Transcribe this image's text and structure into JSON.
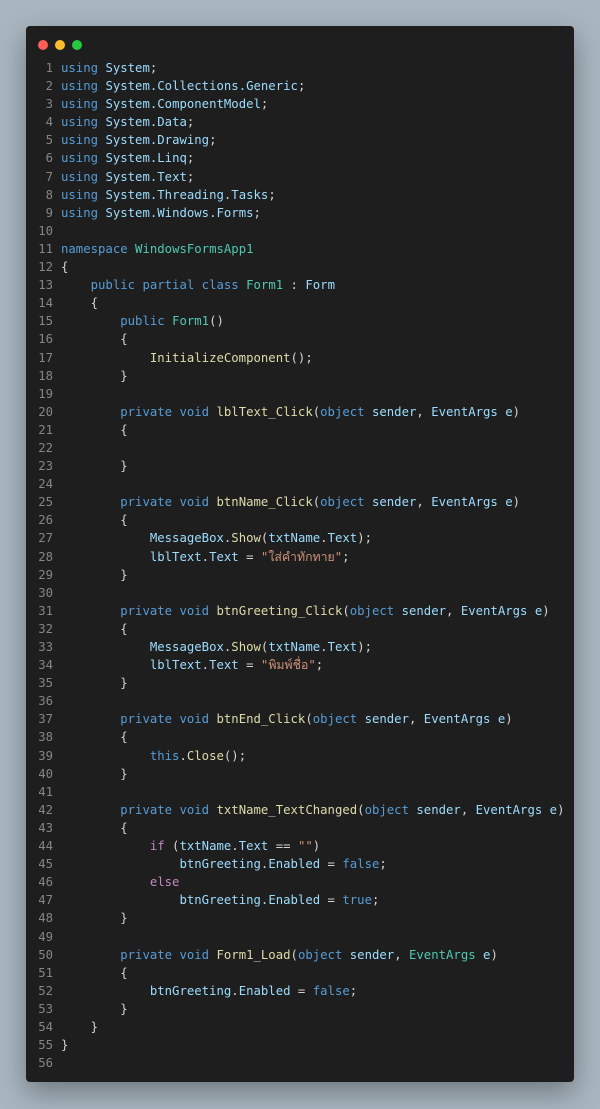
{
  "window": {
    "controls": [
      {
        "name": "close-button",
        "color": "#ff5f56"
      },
      {
        "name": "minimize-button",
        "color": "#ffbd2e"
      },
      {
        "name": "zoom-button",
        "color": "#27c93f"
      }
    ]
  },
  "editor": {
    "lines": [
      [
        [
          "kw",
          "using"
        ],
        [
          "p",
          " "
        ],
        [
          "var",
          "System"
        ],
        [
          "p",
          ";"
        ]
      ],
      [
        [
          "kw",
          "using"
        ],
        [
          "p",
          " "
        ],
        [
          "var",
          "System.Collections.Generic"
        ],
        [
          "p",
          ";"
        ]
      ],
      [
        [
          "kw",
          "using"
        ],
        [
          "p",
          " "
        ],
        [
          "var",
          "System.ComponentModel"
        ],
        [
          "p",
          ";"
        ]
      ],
      [
        [
          "kw",
          "using"
        ],
        [
          "p",
          " "
        ],
        [
          "var",
          "System.Data"
        ],
        [
          "p",
          ";"
        ]
      ],
      [
        [
          "kw",
          "using"
        ],
        [
          "p",
          " "
        ],
        [
          "var",
          "System.Drawing"
        ],
        [
          "p",
          ";"
        ]
      ],
      [
        [
          "kw",
          "using"
        ],
        [
          "p",
          " "
        ],
        [
          "var",
          "System.Linq"
        ],
        [
          "p",
          ";"
        ]
      ],
      [
        [
          "kw",
          "using"
        ],
        [
          "p",
          " "
        ],
        [
          "var",
          "System.Text"
        ],
        [
          "p",
          ";"
        ]
      ],
      [
        [
          "kw",
          "using"
        ],
        [
          "p",
          " "
        ],
        [
          "var",
          "System.Threading.Tasks"
        ],
        [
          "p",
          ";"
        ]
      ],
      [
        [
          "kw",
          "using"
        ],
        [
          "p",
          " "
        ],
        [
          "var",
          "System.Windows.Forms"
        ],
        [
          "p",
          ";"
        ]
      ],
      [],
      [
        [
          "kw",
          "namespace"
        ],
        [
          "p",
          " "
        ],
        [
          "type",
          "WindowsFormsApp1"
        ]
      ],
      [
        [
          "p",
          "{"
        ]
      ],
      [
        [
          "p",
          "    "
        ],
        [
          "kw",
          "public partial class"
        ],
        [
          "p",
          " "
        ],
        [
          "type",
          "Form1"
        ],
        [
          "p",
          " : "
        ],
        [
          "var",
          "Form"
        ]
      ],
      [
        [
          "p",
          "    {"
        ]
      ],
      [
        [
          "p",
          "        "
        ],
        [
          "kw",
          "public"
        ],
        [
          "p",
          " "
        ],
        [
          "type",
          "Form1"
        ],
        [
          "p",
          "()"
        ]
      ],
      [
        [
          "p",
          "        {"
        ]
      ],
      [
        [
          "p",
          "            "
        ],
        [
          "fn",
          "InitializeComponent"
        ],
        [
          "p",
          "();"
        ]
      ],
      [
        [
          "p",
          "        }"
        ]
      ],
      [],
      [
        [
          "p",
          "        "
        ],
        [
          "kw",
          "private void"
        ],
        [
          "p",
          " "
        ],
        [
          "fn",
          "lblText_Click"
        ],
        [
          "p",
          "("
        ],
        [
          "kw",
          "object"
        ],
        [
          "p",
          " "
        ],
        [
          "var",
          "sender"
        ],
        [
          "p",
          ", "
        ],
        [
          "var",
          "EventArgs"
        ],
        [
          "p",
          " "
        ],
        [
          "var",
          "e"
        ],
        [
          "p",
          ")"
        ]
      ],
      [
        [
          "p",
          "        {"
        ]
      ],
      [],
      [
        [
          "p",
          "        }"
        ]
      ],
      [],
      [
        [
          "p",
          "        "
        ],
        [
          "kw",
          "private void"
        ],
        [
          "p",
          " "
        ],
        [
          "fn",
          "btnName_Click"
        ],
        [
          "p",
          "("
        ],
        [
          "kw",
          "object"
        ],
        [
          "p",
          " "
        ],
        [
          "var",
          "sender"
        ],
        [
          "p",
          ", "
        ],
        [
          "var",
          "EventArgs"
        ],
        [
          "p",
          " "
        ],
        [
          "var",
          "e"
        ],
        [
          "p",
          ")"
        ]
      ],
      [
        [
          "p",
          "        {"
        ]
      ],
      [
        [
          "p",
          "            "
        ],
        [
          "var",
          "MessageBox"
        ],
        [
          "p",
          "."
        ],
        [
          "fn",
          "Show"
        ],
        [
          "p",
          "("
        ],
        [
          "var",
          "txtName"
        ],
        [
          "p",
          "."
        ],
        [
          "var",
          "Text"
        ],
        [
          "p",
          ");"
        ]
      ],
      [
        [
          "p",
          "            "
        ],
        [
          "var",
          "lblText"
        ],
        [
          "p",
          "."
        ],
        [
          "var",
          "Text"
        ],
        [
          "p",
          " = "
        ],
        [
          "str",
          "\"ใส่คำทักทาย\""
        ],
        [
          "p",
          ";"
        ]
      ],
      [
        [
          "p",
          "        }"
        ]
      ],
      [],
      [
        [
          "p",
          "        "
        ],
        [
          "kw",
          "private void"
        ],
        [
          "p",
          " "
        ],
        [
          "fn",
          "btnGreeting_Click"
        ],
        [
          "p",
          "("
        ],
        [
          "kw",
          "object"
        ],
        [
          "p",
          " "
        ],
        [
          "var",
          "sender"
        ],
        [
          "p",
          ", "
        ],
        [
          "var",
          "EventArgs"
        ],
        [
          "p",
          " "
        ],
        [
          "var",
          "e"
        ],
        [
          "p",
          ")"
        ]
      ],
      [
        [
          "p",
          "        {"
        ]
      ],
      [
        [
          "p",
          "            "
        ],
        [
          "var",
          "MessageBox"
        ],
        [
          "p",
          "."
        ],
        [
          "fn",
          "Show"
        ],
        [
          "p",
          "("
        ],
        [
          "var",
          "txtName"
        ],
        [
          "p",
          "."
        ],
        [
          "var",
          "Text"
        ],
        [
          "p",
          ");"
        ]
      ],
      [
        [
          "p",
          "            "
        ],
        [
          "var",
          "lblText"
        ],
        [
          "p",
          "."
        ],
        [
          "var",
          "Text"
        ],
        [
          "p",
          " = "
        ],
        [
          "str",
          "\"พิมพ์ชื่อ\""
        ],
        [
          "p",
          ";"
        ]
      ],
      [
        [
          "p",
          "        }"
        ]
      ],
      [],
      [
        [
          "p",
          "        "
        ],
        [
          "kw",
          "private void"
        ],
        [
          "p",
          " "
        ],
        [
          "fn",
          "btnEnd_Click"
        ],
        [
          "p",
          "("
        ],
        [
          "kw",
          "object"
        ],
        [
          "p",
          " "
        ],
        [
          "var",
          "sender"
        ],
        [
          "p",
          ", "
        ],
        [
          "var",
          "EventArgs"
        ],
        [
          "p",
          " "
        ],
        [
          "var",
          "e"
        ],
        [
          "p",
          ")"
        ]
      ],
      [
        [
          "p",
          "        {"
        ]
      ],
      [
        [
          "p",
          "            "
        ],
        [
          "kw",
          "this"
        ],
        [
          "p",
          "."
        ],
        [
          "fn",
          "Close"
        ],
        [
          "p",
          "();"
        ]
      ],
      [
        [
          "p",
          "        }"
        ]
      ],
      [],
      [
        [
          "p",
          "        "
        ],
        [
          "kw",
          "private void"
        ],
        [
          "p",
          " "
        ],
        [
          "fn",
          "txtName_TextChanged"
        ],
        [
          "p",
          "("
        ],
        [
          "kw",
          "object"
        ],
        [
          "p",
          " "
        ],
        [
          "var",
          "sender"
        ],
        [
          "p",
          ", "
        ],
        [
          "var",
          "EventArgs"
        ],
        [
          "p",
          " "
        ],
        [
          "var",
          "e"
        ],
        [
          "p",
          ")"
        ]
      ],
      [
        [
          "p",
          "        {"
        ]
      ],
      [
        [
          "p",
          "            "
        ],
        [
          "ctl",
          "if"
        ],
        [
          "p",
          " ("
        ],
        [
          "var",
          "txtName"
        ],
        [
          "p",
          "."
        ],
        [
          "var",
          "Text"
        ],
        [
          "p",
          " == "
        ],
        [
          "str",
          "\"\""
        ],
        [
          "p",
          ")"
        ]
      ],
      [
        [
          "p",
          "                "
        ],
        [
          "var",
          "btnGreeting"
        ],
        [
          "p",
          "."
        ],
        [
          "var",
          "Enabled"
        ],
        [
          "p",
          " = "
        ],
        [
          "kw",
          "false"
        ],
        [
          "p",
          ";"
        ]
      ],
      [
        [
          "p",
          "            "
        ],
        [
          "ctl",
          "else"
        ]
      ],
      [
        [
          "p",
          "                "
        ],
        [
          "var",
          "btnGreeting"
        ],
        [
          "p",
          "."
        ],
        [
          "var",
          "Enabled"
        ],
        [
          "p",
          " = "
        ],
        [
          "kw",
          "true"
        ],
        [
          "p",
          ";"
        ]
      ],
      [
        [
          "p",
          "        }"
        ]
      ],
      [],
      [
        [
          "p",
          "        "
        ],
        [
          "kw",
          "private void"
        ],
        [
          "p",
          " "
        ],
        [
          "fn",
          "Form1_Load"
        ],
        [
          "p",
          "("
        ],
        [
          "kw",
          "object"
        ],
        [
          "p",
          " "
        ],
        [
          "var",
          "sender"
        ],
        [
          "p",
          ", "
        ],
        [
          "type",
          "EventArgs"
        ],
        [
          "p",
          " "
        ],
        [
          "var",
          "e"
        ],
        [
          "p",
          ")"
        ]
      ],
      [
        [
          "p",
          "        {"
        ]
      ],
      [
        [
          "p",
          "            "
        ],
        [
          "var",
          "btnGreeting"
        ],
        [
          "p",
          "."
        ],
        [
          "var",
          "Enabled"
        ],
        [
          "p",
          " = "
        ],
        [
          "kw",
          "false"
        ],
        [
          "p",
          ";"
        ]
      ],
      [
        [
          "p",
          "        }"
        ]
      ],
      [
        [
          "p",
          "    }"
        ]
      ],
      [
        [
          "p",
          "}"
        ]
      ],
      []
    ]
  }
}
